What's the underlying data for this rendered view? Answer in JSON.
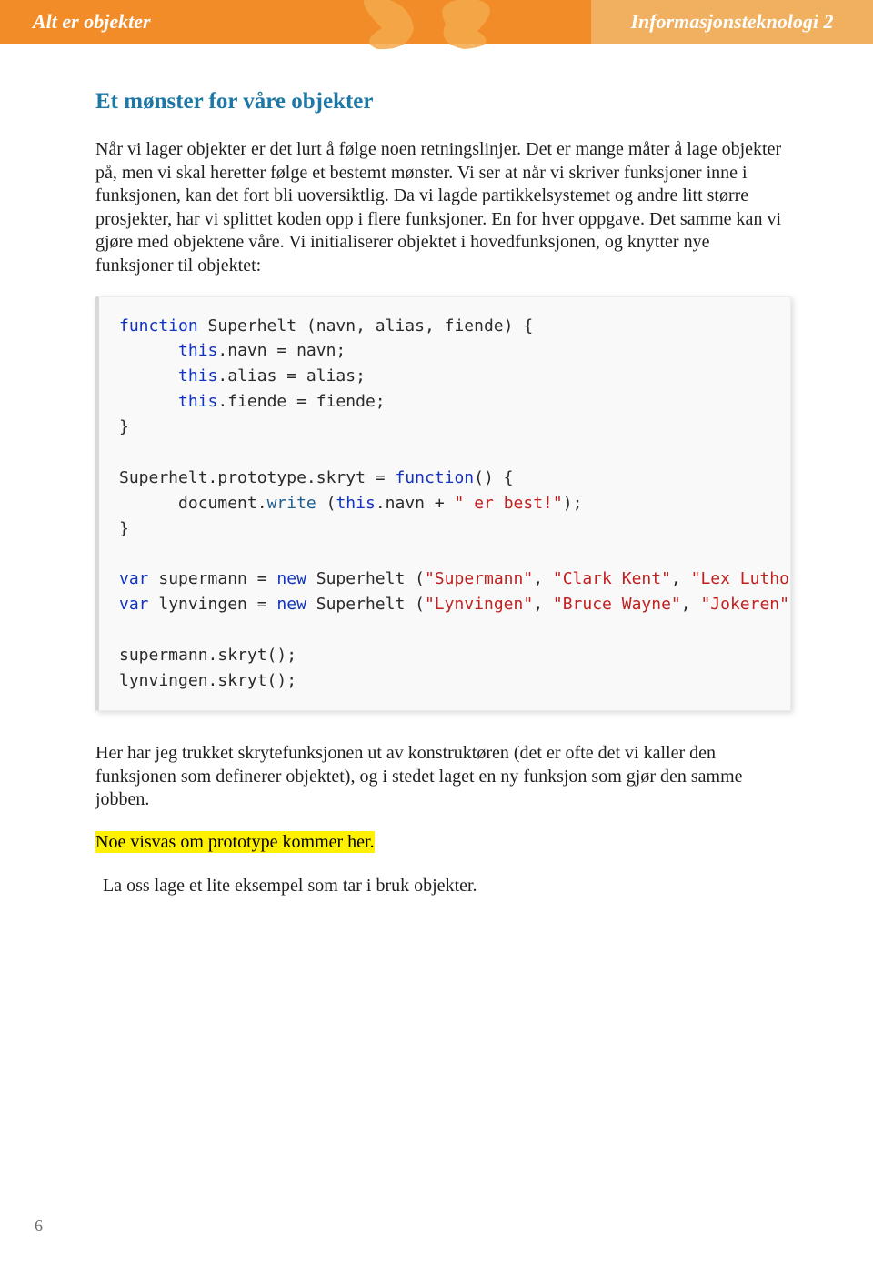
{
  "header": {
    "left_title": "Alt er objekter",
    "right_title": "Informasjonsteknologi 2"
  },
  "heading": "Et mønster for våre objekter",
  "intro": "Når vi lager objekter er det lurt å følge noen retningslinjer. Det er mange måter å lage objekter på, men vi skal heretter følge et bestemt mønster. Vi ser at når vi skriver funksjoner inne i funksjonen, kan det fort bli uoversiktlig. Da vi lagde partikkelsystemet og andre litt større prosjekter, har vi splittet koden opp i flere funksjoner. En for hver oppgave. Det samme kan vi gjøre med objektene våre. Vi initialiserer objektet i hovedfunksjonen, og knytter nye funksjoner til objektet:",
  "code": {
    "l1_kw": "function",
    "l1_rest": " Superhelt (navn, alias, fiende) {",
    "l2_this": "this",
    "l2_rest": ".navn = navn;",
    "l3_this": "this",
    "l3_rest": ".alias = alias;",
    "l4_this": "this",
    "l4_rest": ".fiende = fiende;",
    "l5": "}",
    "l6_a": "Superhelt.prototype.skryt = ",
    "l6_kw": "function",
    "l6_b": "() {",
    "l7_a": "document.",
    "l7_fn": "write",
    "l7_b": " (",
    "l7_this": "this",
    "l7_c": ".navn + ",
    "l7_str": "\" er best!\"",
    "l7_d": ");",
    "l8": "}",
    "l9_var": "var",
    "l9_a": " supermann = ",
    "l9_new": "new",
    "l9_b": " Superhelt (",
    "l9_s1": "\"Supermann\"",
    "l9_c": ", ",
    "l9_s2": "\"Clark Kent\"",
    "l9_d": ", ",
    "l9_s3": "\"Lex Luthor\"",
    "l9_e": ");",
    "l10_var": "var",
    "l10_a": " lynvingen = ",
    "l10_new": "new",
    "l10_b": " Superhelt (",
    "l10_s1": "\"Lynvingen\"",
    "l10_c": ", ",
    "l10_s2": "\"Bruce Wayne\"",
    "l10_d": ", ",
    "l10_s3": "\"Jokeren\"",
    "l10_e": ");",
    "l11": "supermann.skryt();",
    "l12": "lynvingen.skryt();"
  },
  "para2": "Her har jeg trukket skrytefunksjonen ut av konstruktøren (det er ofte det vi kaller den funksjonen som definerer objektet), og i stedet laget en ny funksjon som gjør den samme jobben.",
  "highlight": "Noe visvas om prototype kommer her.",
  "para3": "La oss lage et lite eksempel som tar i bruk objekter.",
  "page_number": "6"
}
